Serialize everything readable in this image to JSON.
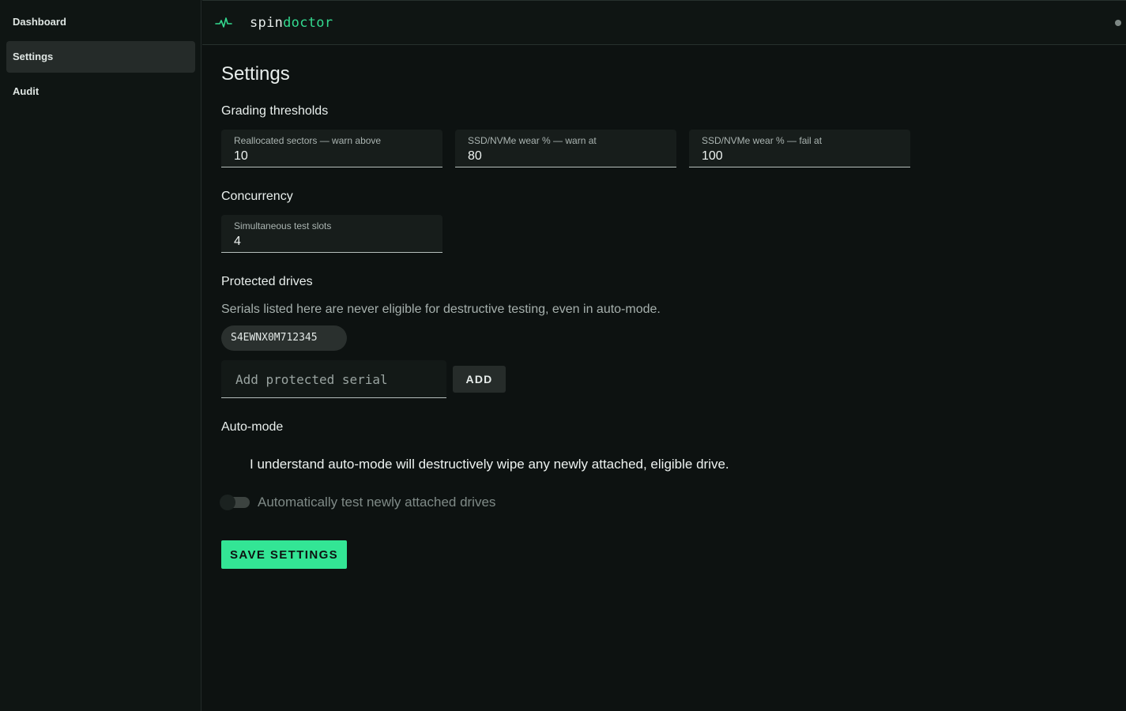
{
  "sidebar": {
    "items": [
      {
        "label": "Dashboard"
      },
      {
        "label": "Settings"
      },
      {
        "label": "Audit"
      }
    ]
  },
  "appbar": {
    "logo_icon": "pulse-icon",
    "brand_part1": "spin",
    "brand_part2": "doctor"
  },
  "page": {
    "title": "Settings"
  },
  "thresholds": {
    "section_title": "Grading thresholds",
    "realloc_label": "Reallocated sectors — warn above",
    "realloc_value": "10",
    "wear_warn_label": "SSD/NVMe wear % — warn at",
    "wear_warn_value": "80",
    "wear_fail_label": "SSD/NVMe wear % — fail at",
    "wear_fail_value": "100"
  },
  "concurrency": {
    "section_title": "Concurrency",
    "slots_label": "Simultaneous test slots",
    "slots_value": "4"
  },
  "protected": {
    "section_title": "Protected drives",
    "description": "Serials listed here are never eligible for destructive testing, even in auto-mode.",
    "serials": [
      "S4EWNX0M712345"
    ],
    "input_placeholder": "Add protected serial",
    "add_label": "ADD"
  },
  "automode": {
    "section_title": "Auto-mode",
    "acknowledgement": "I understand auto-mode will destructively wipe any newly attached, eligible drive.",
    "toggle_label": "Automatically test newly attached drives",
    "toggle_on": false
  },
  "actions": {
    "save_label": "SAVE SETTINGS"
  },
  "colors": {
    "accent": "#33e595",
    "background": "#0d1211"
  }
}
